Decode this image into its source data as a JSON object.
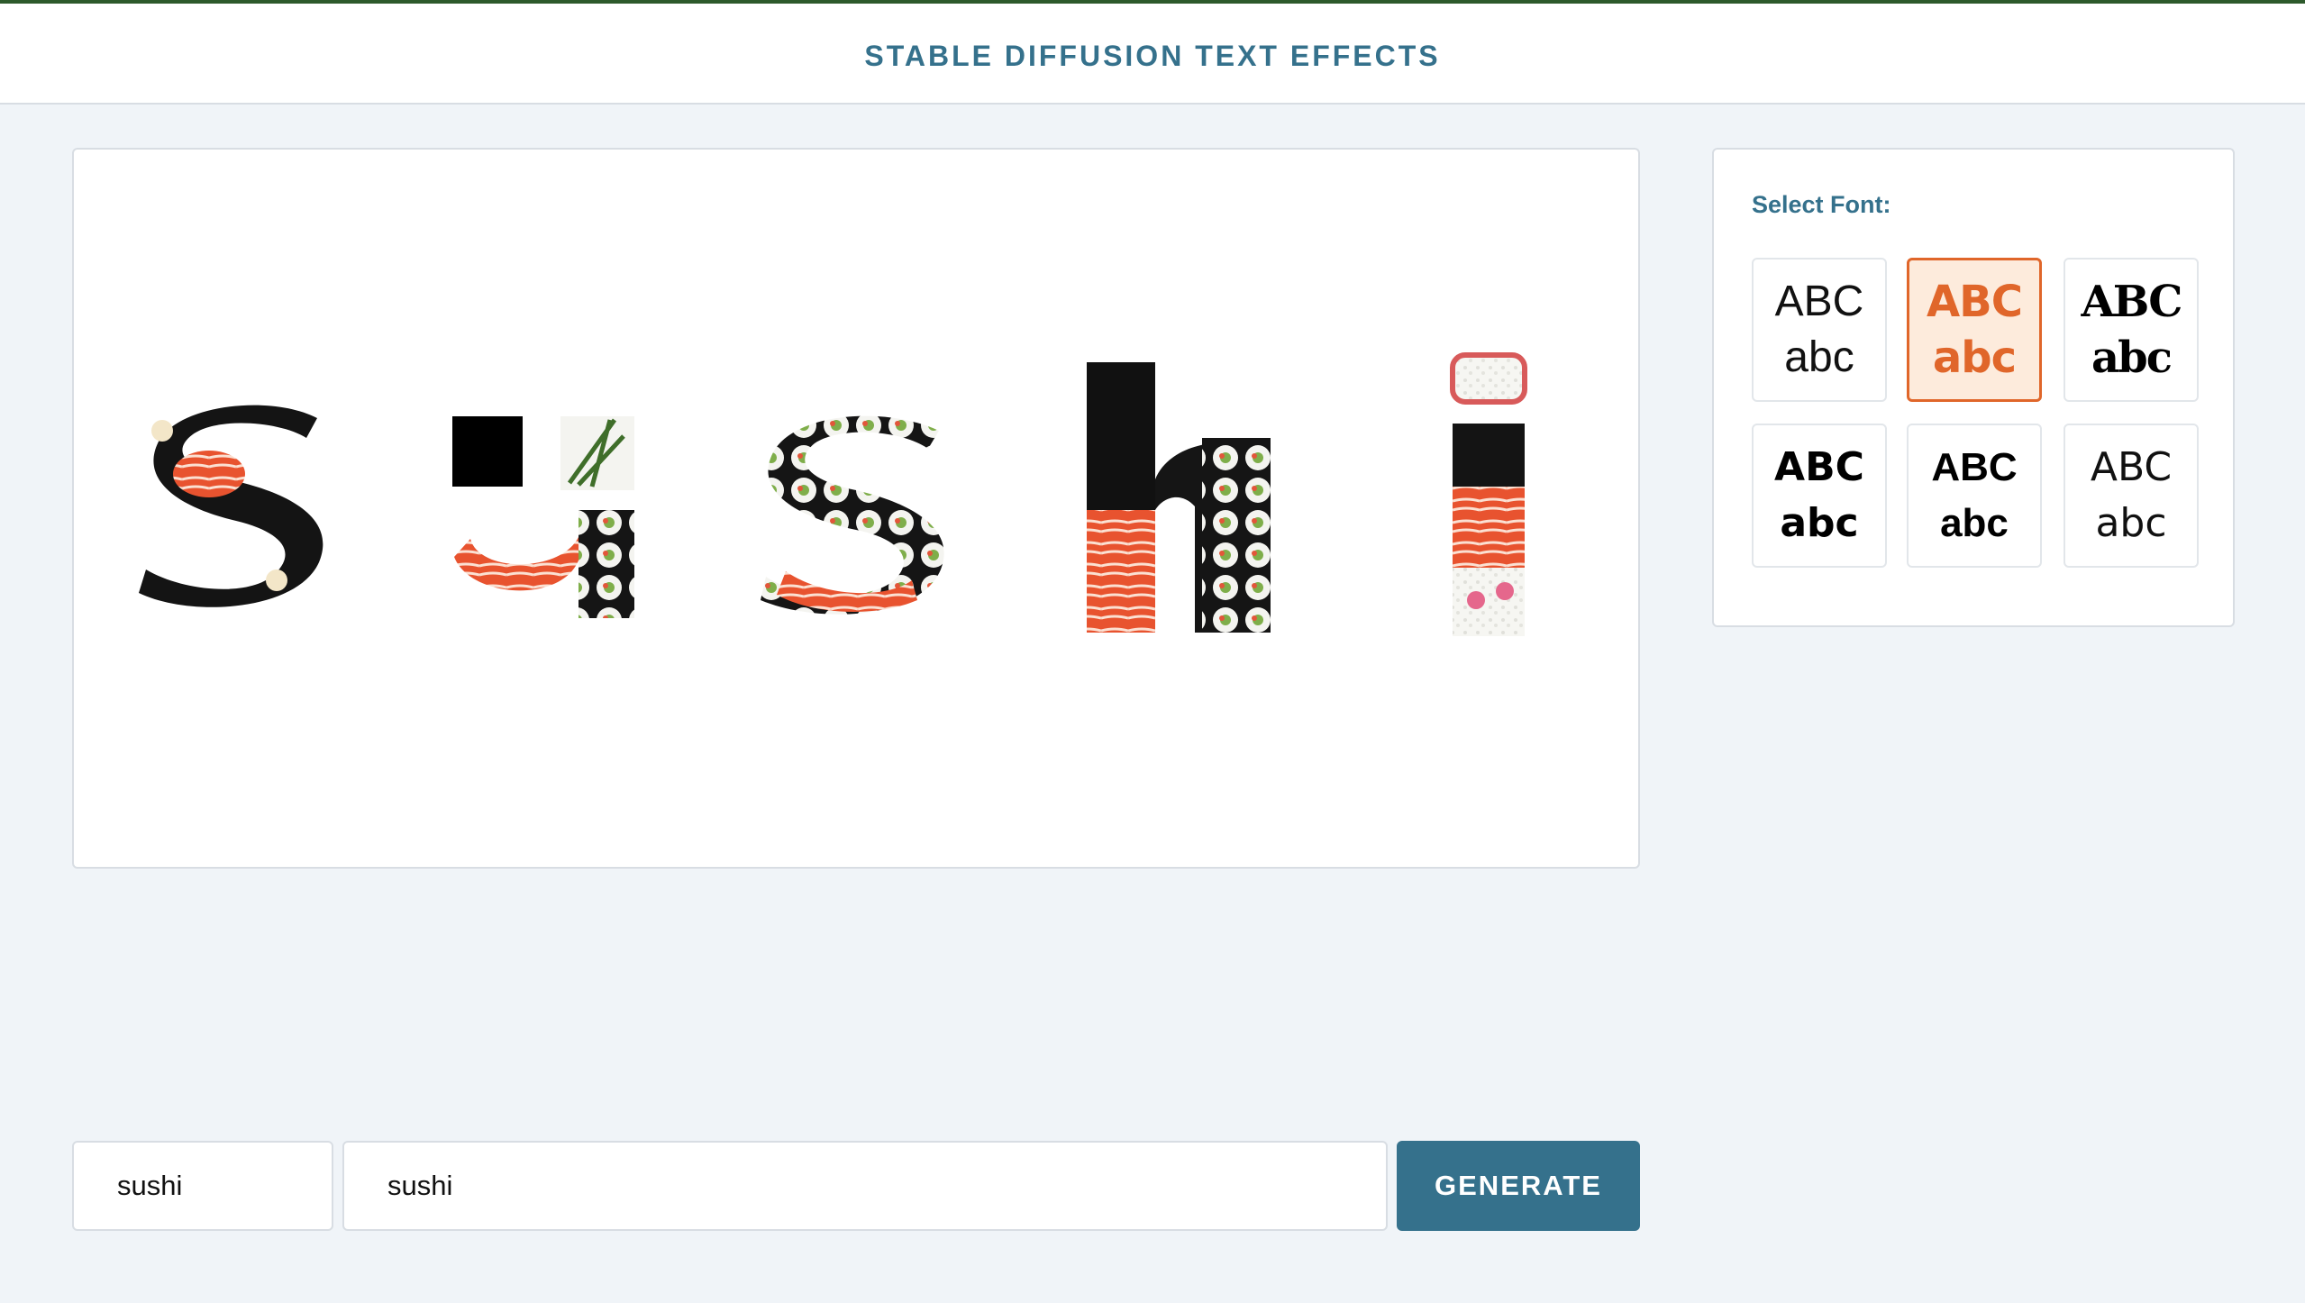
{
  "header": {
    "title": "STABLE DIFFUSION TEXT EFFECTS"
  },
  "canvas": {
    "rendered_word": "sushi",
    "effect_theme": "sushi"
  },
  "font_panel": {
    "label": "Select Font:",
    "selected_index": 1,
    "fonts": [
      {
        "upper": "ABC",
        "lower": "abc"
      },
      {
        "upper": "ABC",
        "lower": "abc"
      },
      {
        "upper": "ABC",
        "lower": "abc"
      },
      {
        "upper": "ABC",
        "lower": "abc"
      },
      {
        "upper": "ABC",
        "lower": "abc"
      },
      {
        "upper": "ABC",
        "lower": "abc"
      }
    ]
  },
  "controls": {
    "text_value": "sushi",
    "prompt_value": "sushi",
    "generate_label": "GENERATE"
  },
  "colors": {
    "accent": "#35718c",
    "selected_font": "#e0662a",
    "top_border": "#2d5a2c"
  }
}
